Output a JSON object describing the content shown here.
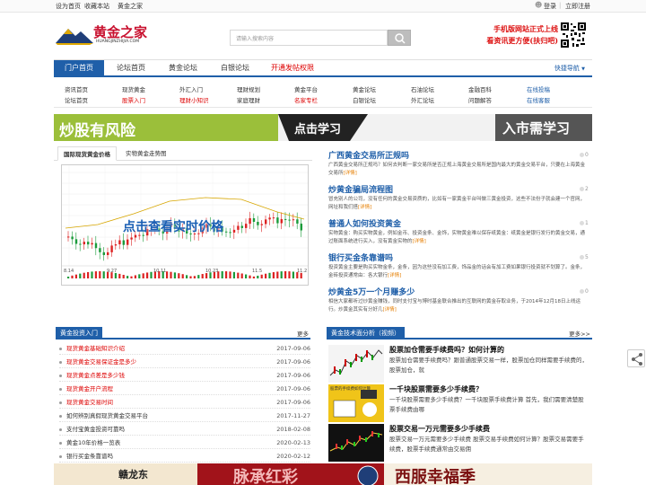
{
  "topbar": {
    "set_home": "设为首页",
    "bookmark": "收藏本站",
    "site_name": "黄金之家",
    "login": "登录",
    "separator": "|",
    "register": "立即注册"
  },
  "header": {
    "logo_text": "黄金之家",
    "logo_domain": "HUANGJINZHIJIA.COM",
    "search_placeholder": "请输入搜索内容",
    "promo_line1": "手机版网站正式上线",
    "promo_line2": "看资讯更方便(扶归吧)"
  },
  "nav": {
    "items": [
      {
        "label": "门户首页"
      },
      {
        "label": "论坛首页"
      },
      {
        "label": "黄金论坛"
      },
      {
        "label": "白银论坛"
      },
      {
        "label": "开通发帖权限"
      }
    ],
    "quick_nav": "快捷导航"
  },
  "subnav": {
    "row1": [
      "资讯首页",
      "现货黄金",
      "外汇入门",
      "理财规划",
      "黄金平台",
      "黄金论坛",
      "石油论坛",
      "金融百科",
      "在线投稿"
    ],
    "row2": [
      "论坛首页",
      "股票入门",
      "理财小知识",
      "家庭理财",
      "名家专栏",
      "白银论坛",
      "外汇论坛",
      "问题解答",
      "在线客服"
    ]
  },
  "banner": {
    "left_text": "炒股有风险",
    "center_text": "点击学习",
    "right_text": "入市需学习"
  },
  "chart_tabs": {
    "tab1": "国际现货黄金价格",
    "tab2": "实物黄金走势图"
  },
  "chart_panel": {
    "overlay_text": "点击查看实时价格",
    "x_ticks": [
      "8.14",
      "9.27",
      "10.11",
      "10.23",
      "11.5",
      "11.2"
    ]
  },
  "news": [
    {
      "title": "广西黄金交易所正规吗",
      "desc": "广西黄金交易所正规吗？如何去判断一家交易所是否正规上海黄金交易所是国内最大的黄金交易平台，只要在上海黄金交易所",
      "more": "[详情]",
      "count": "0"
    },
    {
      "title": "炒黄金骗局流程图",
      "desc": "冒充别人的公司，没有任何的黄金交易资质的，比如有一家黄金平台叫做三黄金投资，这些不法份子就会建一个官网，网址和我们搭",
      "more": "[详情]",
      "count": "2"
    },
    {
      "title": "普通人如何投资黄金",
      "desc": "实物黄金：购买实物黄金，例如金币、投资金条、金饰，实物黄金难以保存纸黄金：纸黄金是银行发行的黄金交易，通过账面系统进行买入，没有黄金实物的",
      "more": "[详情]",
      "count": "1"
    },
    {
      "title": "银行买金条靠谱吗",
      "desc": "投资黄金主要是购买实物金条，金条，因为这些没有加工费，饰品金的话会有加工费如果银行投资就不划算了。金条，金砖投资通常由：各大银行",
      "more": "[详情]",
      "count": "5"
    },
    {
      "title": "炒黄金5万一个月赚多少",
      "desc": "相信大家都听过炒黄金赚钱，同时支付宝与博时基金联合推出的互联网的黄金存取业务，于2014年12月18日上线运行。炒黄金其实有分好几",
      "more": "[详情]",
      "count": "0"
    }
  ],
  "invest_section": {
    "title": "黄金投资入门",
    "more": "更多",
    "items": [
      {
        "text": "现货黄金基础知识介绍",
        "date": "2017-09-06",
        "red": true
      },
      {
        "text": "现货黄金交易保证金是多少",
        "date": "2017-09-06",
        "red": true
      },
      {
        "text": "现货黄金点差是多少钱",
        "date": "2017-09-06",
        "red": true
      },
      {
        "text": "现货黄金开户流程",
        "date": "2017-09-06",
        "red": true
      },
      {
        "text": "现货黄金交易时间",
        "date": "2017-09-06",
        "red": true
      },
      {
        "text": "如何辨别真假现货黄金交易平台",
        "date": "2017-11-27",
        "red": false
      },
      {
        "text": "支付宝黄金投资可靠吗",
        "date": "2018-02-08",
        "red": false
      },
      {
        "text": "黄金10年价格一览表",
        "date": "2020-02-13",
        "red": false
      },
      {
        "text": "银行买金条靠谱吗",
        "date": "2020-02-12",
        "red": false
      }
    ]
  },
  "video_section": {
    "title": "黄金技术面分析（视频）",
    "more": "更多>>",
    "items": [
      {
        "title": "股票加仓需要手续费吗？如何计算的",
        "desc": "股票加仓需要手续费吗？跟普通股票交易一样，股票加仓同样需要手续费的，股票加仓，就",
        "thumb_caption": ""
      },
      {
        "title": "一千块股票需要多少手续费？",
        "desc": "一千块股票需要多少手续费？一千块股票手续费计算 首先，我们需要清楚股票手续费由哪",
        "thumb_caption": "股票的手续费如何计算"
      },
      {
        "title": "股票交易一万元需要多少手续费",
        "desc": "股票交易一万元需要多少手续费 股票交易手续费如何计算？股票交易需要手续费，股票手续费通常由交易佣",
        "thumb_caption": ""
      }
    ]
  },
  "bottom_banner": {
    "left_text": "赣龙东",
    "center_text": "脉承红彩",
    "right_text": "西服幸福季"
  },
  "colors": {
    "brand_blue": "#1f5fa9",
    "accent_red": "#d00000",
    "banner_green": "#9bbf3a"
  }
}
